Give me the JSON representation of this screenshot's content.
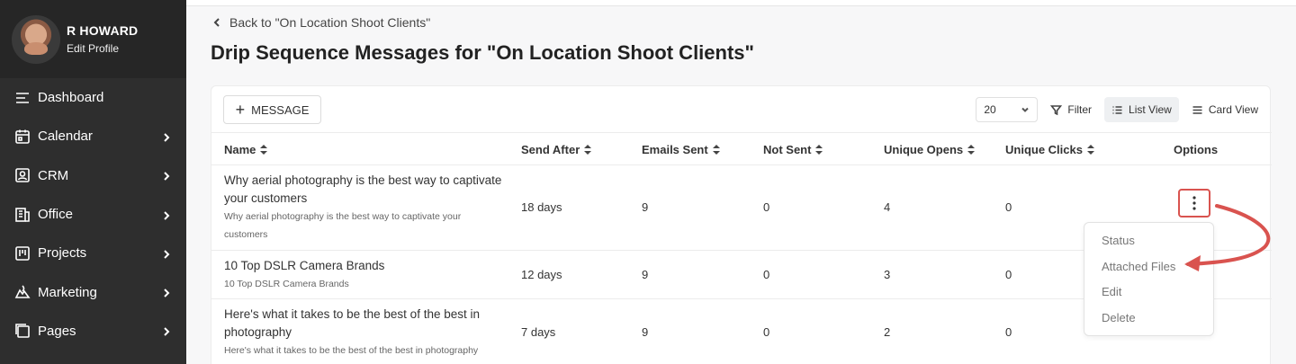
{
  "profile": {
    "name": "R HOWARD",
    "edit": "Edit Profile"
  },
  "sidebar": {
    "items": [
      {
        "label": "Dashboard",
        "icon": "menu-icon"
      },
      {
        "label": "Calendar",
        "icon": "calendar-icon"
      },
      {
        "label": "CRM",
        "icon": "contact-icon"
      },
      {
        "label": "Office",
        "icon": "office-icon"
      },
      {
        "label": "Projects",
        "icon": "projects-icon"
      },
      {
        "label": "Marketing",
        "icon": "marketing-icon"
      },
      {
        "label": "Pages",
        "icon": "pages-icon"
      }
    ]
  },
  "header": {
    "back_label": "Back to \"On Location Shoot Clients\"",
    "title": "Drip Sequence Messages for \"On Location Shoot Clients\""
  },
  "toolbar": {
    "message_label": "MESSAGE",
    "page_size": "20",
    "filter_label": "Filter",
    "list_view_label": "List View",
    "card_view_label": "Card View"
  },
  "table": {
    "columns": [
      "Name",
      "Send After",
      "Emails Sent",
      "Not Sent",
      "Unique Opens",
      "Unique Clicks",
      "Options"
    ],
    "rows": [
      {
        "name_line1": "Why aerial photography is the best way to captivate",
        "name_line2": "your customers",
        "sub_line1": "Why aerial photography is the best way to captivate your",
        "sub_line2": "customers",
        "send_after": "18 days",
        "emails_sent": "9",
        "not_sent": "0",
        "unique_opens": "4",
        "unique_clicks": "0"
      },
      {
        "name_line1": "10 Top DSLR Camera Brands",
        "name_line2": "",
        "sub_line1": "10 Top DSLR Camera Brands",
        "sub_line2": "",
        "send_after": "12 days",
        "emails_sent": "9",
        "not_sent": "0",
        "unique_opens": "3",
        "unique_clicks": "0"
      },
      {
        "name_line1": "Here's what it takes to be the best of the best in",
        "name_line2": "photography",
        "sub_line1": "Here's what it takes to be the best of the best in photography",
        "sub_line2": "",
        "send_after": "7 days",
        "emails_sent": "9",
        "not_sent": "0",
        "unique_opens": "2",
        "unique_clicks": "0"
      }
    ]
  },
  "options_menu": {
    "items": [
      "Status",
      "Attached Files",
      "Edit",
      "Delete"
    ]
  },
  "colors": {
    "sidebar_bg": "#2e2e2e",
    "annotation_red": "#d9534f"
  }
}
